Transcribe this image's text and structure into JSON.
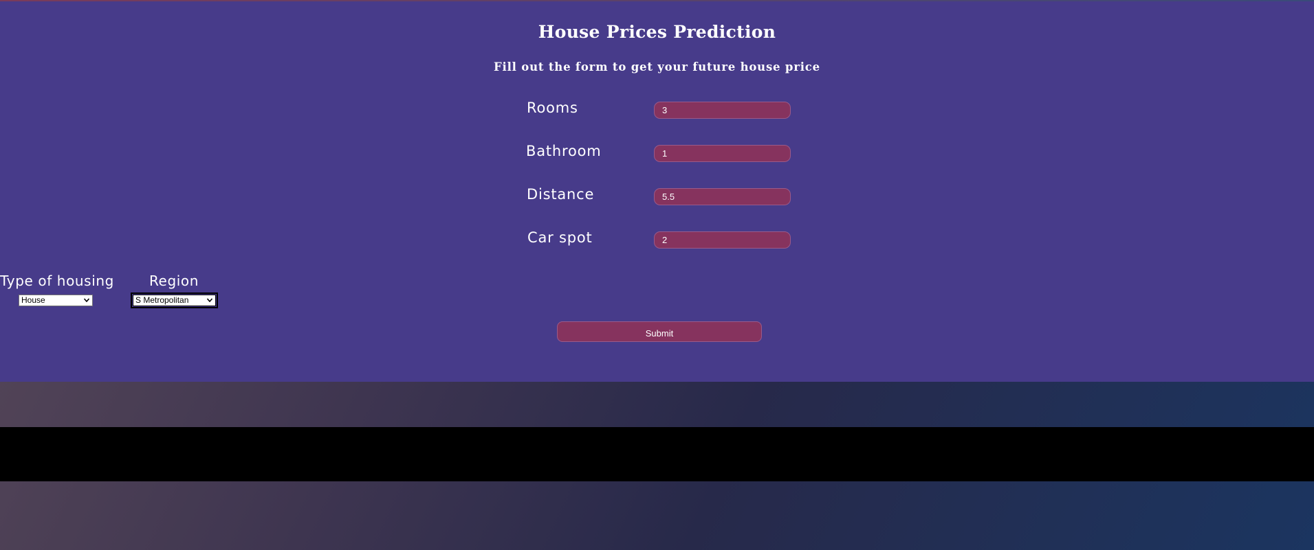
{
  "page": {
    "title": "House Prices Prediction",
    "subtitle": "Fill out the form to get your future house price"
  },
  "form": {
    "fields": [
      {
        "label": "Rooms",
        "value": "3"
      },
      {
        "label": "Bathroom",
        "value": "1"
      },
      {
        "label": "Distance",
        "value": "5.5"
      },
      {
        "label": "Car spot",
        "value": "2"
      }
    ],
    "type_of_housing": {
      "label": "Type of housing",
      "selected": "House"
    },
    "region": {
      "label": "Region",
      "selected": "S Metropolitan"
    },
    "submit_label": "Submit"
  },
  "colors": {
    "panel_bg": "#473b8a",
    "input_bg": "#86335e",
    "text": "#ffffff"
  },
  "icons": {
    "select_arrow": "chevron-down-icon"
  }
}
